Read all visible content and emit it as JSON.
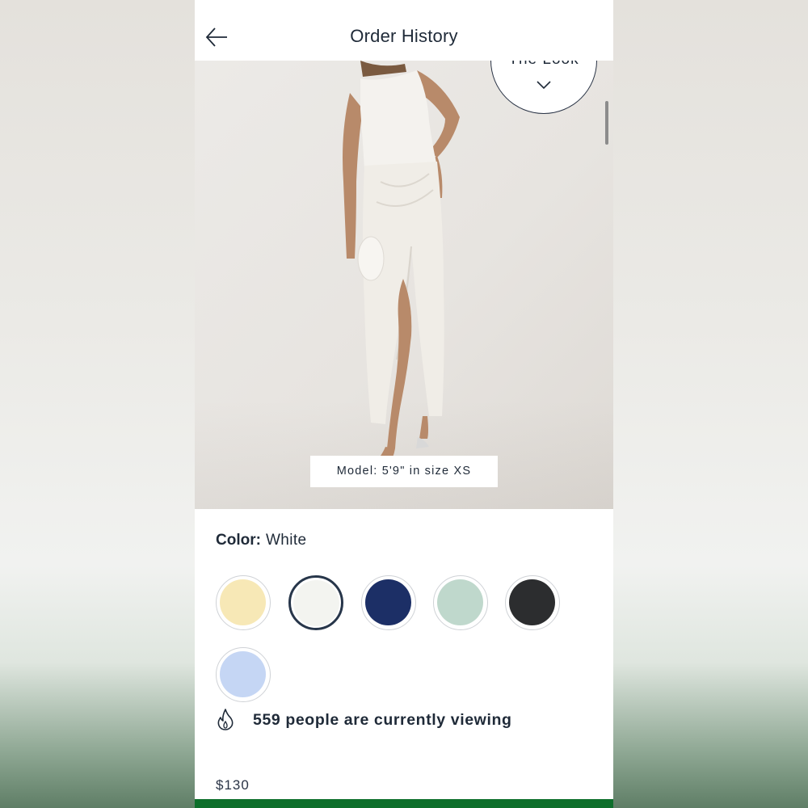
{
  "header": {
    "title": "Order History",
    "back_icon": "arrow-left-icon"
  },
  "hero": {
    "look_button_label": "The Look",
    "look_button_icon": "chevron-down-icon",
    "model_info": "Model: 5'9\" in size XS"
  },
  "color": {
    "label": "Color:",
    "selected_value": "White",
    "swatches": [
      {
        "name": "yellow",
        "hex": "#f7e8b6",
        "selected": false
      },
      {
        "name": "white",
        "hex": "#f3f4f0",
        "selected": true
      },
      {
        "name": "navy",
        "hex": "#1c2f66",
        "selected": false
      },
      {
        "name": "sage",
        "hex": "#bfd8cc",
        "selected": false
      },
      {
        "name": "black",
        "hex": "#2c2d2f",
        "selected": false
      },
      {
        "name": "light-blue",
        "hex": "#c5d6f4",
        "selected": false
      }
    ]
  },
  "viewing": {
    "icon": "flame-icon",
    "text": "559 people are currently viewing"
  },
  "product": {
    "price": "$130"
  },
  "colors": {
    "text_primary": "#1f2a38",
    "cta_green": "#0d6f2b"
  }
}
